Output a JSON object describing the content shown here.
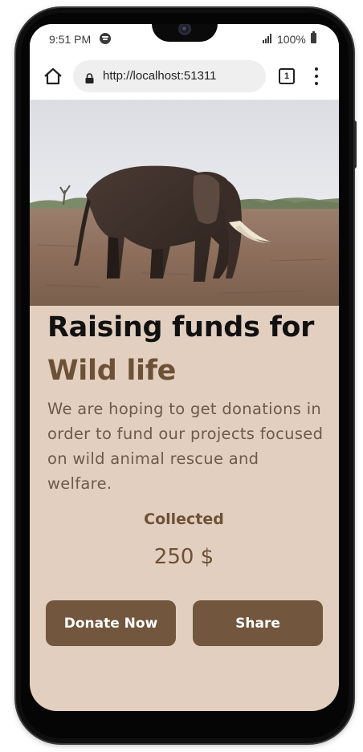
{
  "status_bar": {
    "time": "9:51 PM",
    "battery": "100%",
    "icons": [
      "spotify-icon",
      "signal-icon",
      "battery-icon"
    ]
  },
  "browser": {
    "url": "http://localhost:51311",
    "tab_count": "1",
    "icons": [
      "home-icon",
      "lock-icon",
      "tabs-icon",
      "menu-icon"
    ]
  },
  "hero": {
    "image": "elephant-photo"
  },
  "page": {
    "title_line1": "Raising funds for",
    "title_line2": "Wild life",
    "description": "We are hoping to get donations in order to fund our projects focused on wild animal rescue and welfare.",
    "collected_label": "Collected",
    "collected_value": "250 $",
    "donate_button": "Donate Now",
    "share_button": "Share"
  },
  "colors": {
    "background": "#e2cfbf",
    "accent": "#72563d",
    "title_dark": "#111111",
    "title_accent": "#6d5136"
  }
}
